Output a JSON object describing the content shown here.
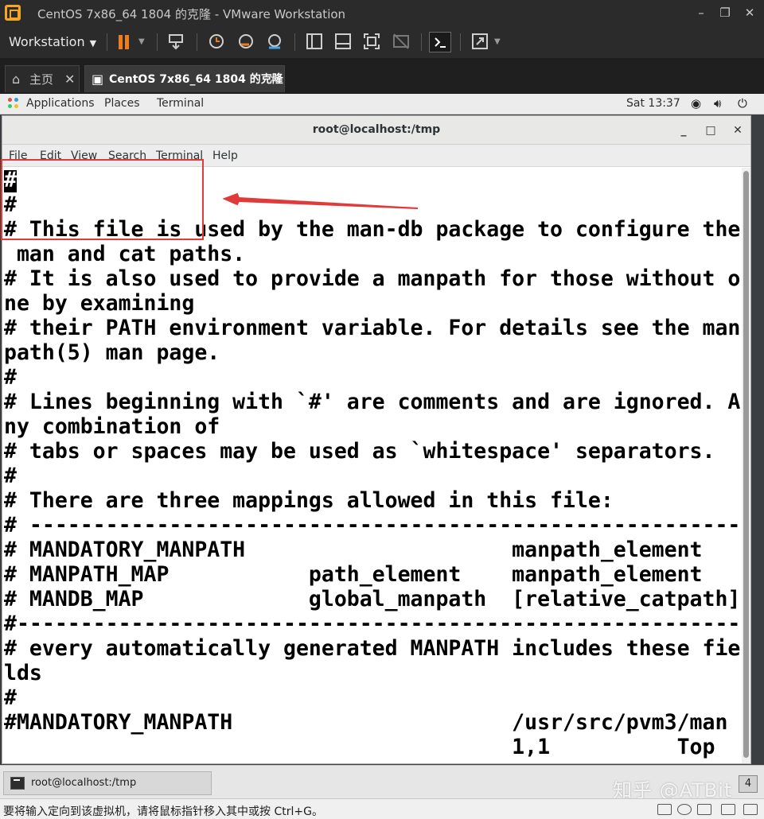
{
  "vmware": {
    "window_title": "CentOS 7x86_64 1804 的克隆 - VMware Workstation",
    "window_controls": {
      "minimize": "–",
      "restore": "❐",
      "close": "✕"
    },
    "workstation_menu": "Workstation",
    "tabs": [
      {
        "label": "主页",
        "icon": "home-icon",
        "close": "✕"
      },
      {
        "label": "CentOS 7x86_64 1804 的克隆",
        "icon": "vm-icon",
        "close": "✕"
      }
    ],
    "status_text": "要将输入定向到该虚拟机，请将鼠标指针移入其中或按 Ctrl+G。",
    "pause_color": "#f07d1d"
  },
  "gnome": {
    "applications": "Applications",
    "places": "Places",
    "terminal": "Terminal",
    "clock": "Sat 13:37"
  },
  "terminal": {
    "title": "root@localhost:/tmp",
    "menu": [
      "File",
      "Edit",
      "View",
      "Search",
      "Terminal",
      "Help"
    ],
    "cursor_char": "#",
    "lines": [
      "",
      "#",
      "# This file is used by the man-db package to configure the",
      " man and cat paths.",
      "# It is also used to provide a manpath for those without o",
      "ne by examining",
      "# their PATH environment variable. For details see the man",
      "path(5) man page.",
      "#",
      "# Lines beginning with `#' are comments and are ignored. A",
      "ny combination of",
      "# tabs or spaces may be used as `whitespace' separators.",
      "#",
      "# There are three mappings allowed in this file:",
      "# --------------------------------------------------------",
      "# MANDATORY_MANPATH                     manpath_element",
      "# MANPATH_MAP           path_element    manpath_element",
      "# MANDB_MAP             global_manpath  [relative_catpath]",
      "#---------------------------------------------------------",
      "# every automatically generated MANPATH includes these fie",
      "lds",
      "#",
      "#MANDATORY_MANPATH                      /usr/src/pvm3/man",
      "                                        1,1          Top"
    ]
  },
  "taskbar": {
    "item": "root@localhost:/tmp",
    "workspace": "4"
  },
  "watermark": "知乎 @ATBit",
  "annotation_color": "#e03a3a"
}
